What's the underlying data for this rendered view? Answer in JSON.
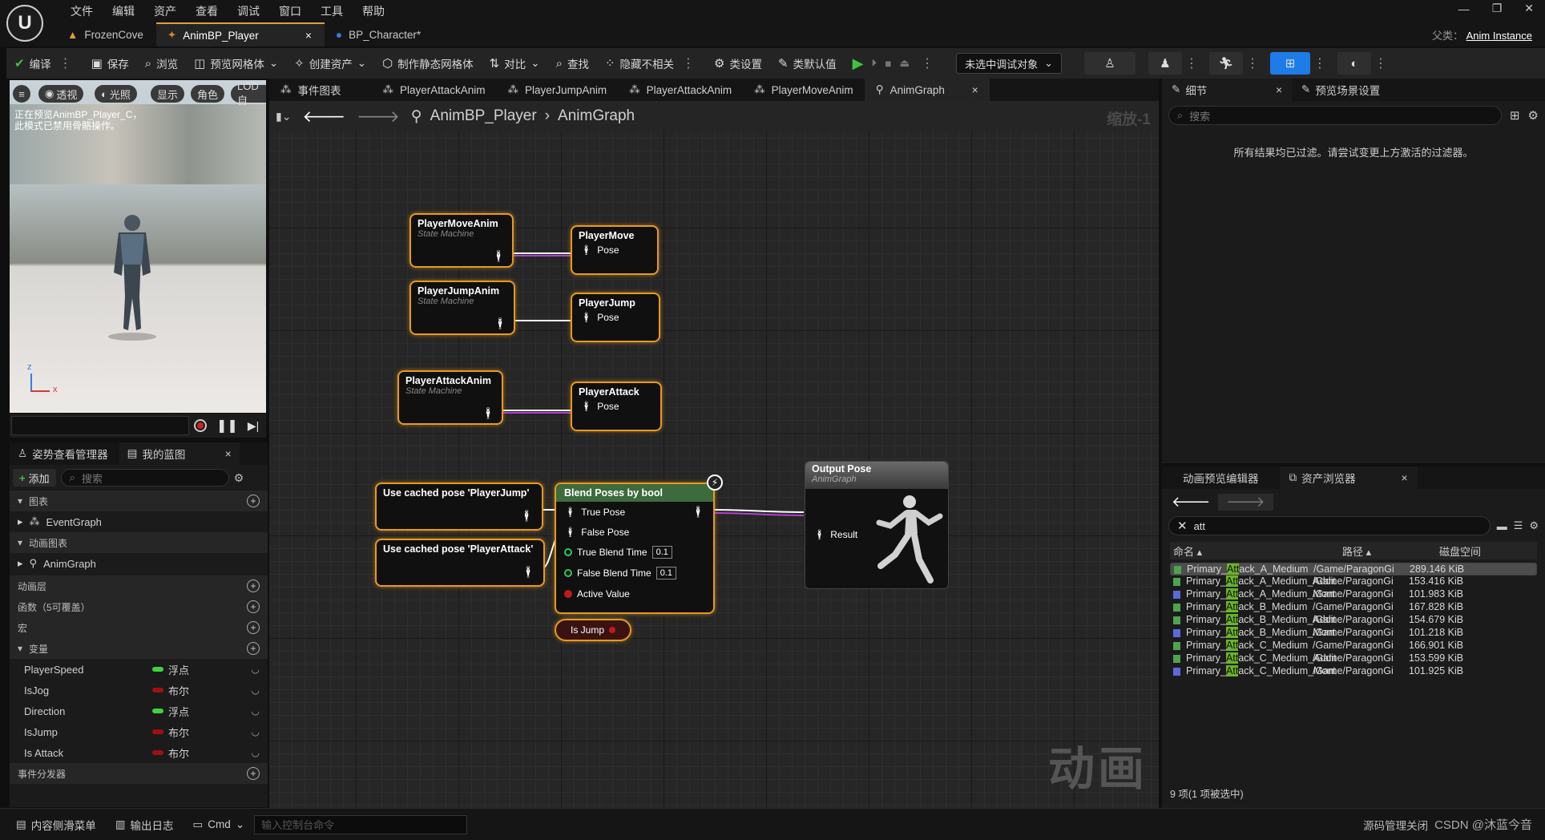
{
  "app": {
    "logo": "U"
  },
  "menu": [
    "文件",
    "编辑",
    "资产",
    "查看",
    "调试",
    "窗口",
    "工具",
    "帮助"
  ],
  "window_controls": [
    "—",
    "❐",
    "✕"
  ],
  "doc_tabs": [
    {
      "label": "FrozenCove",
      "icon": "level-icon"
    },
    {
      "label": "AnimBP_Player",
      "icon": "anim-icon",
      "close": "×"
    },
    {
      "label": "BP_Character*",
      "icon": "character-icon"
    }
  ],
  "parent": {
    "label": "父类：",
    "value": "Anim Instance"
  },
  "toolbar": {
    "compile": "编译",
    "save": "保存",
    "browse": "浏览",
    "preview_mesh": "预览网格体",
    "create_asset": "创建资产",
    "make_static": "制作静态网格体",
    "diff": "对比",
    "find": "查找",
    "hide_unrelated": "隐藏不相关",
    "class_settings": "类设置",
    "class_defaults": "类默认值",
    "debug_select": "未选中调试对象"
  },
  "viewport": {
    "buttons": [
      "≡",
      "透视",
      "光照",
      "显示",
      "角色",
      "LOD自"
    ],
    "notice_line1": "正在预览AnimBP_Player_C，",
    "notice_line2": "此模式已禁用骨骼操作。",
    "axis_x": "x",
    "axis_z": "z"
  },
  "left_panel": {
    "tab1": "姿势查看管理器",
    "tab2": "我的蓝图",
    "add": "添加",
    "search_placeholder": "搜索",
    "sections": {
      "graphs": "图表",
      "event_graph": "EventGraph",
      "anim_graphs": "动画图表",
      "anim_graph": "AnimGraph",
      "anim_layers": "动画层",
      "functions": "函数（5可覆盖）",
      "macros": "宏",
      "variables": "变量",
      "dispatchers": "事件分发器"
    },
    "variables": [
      {
        "name": "PlayerSpeed",
        "type": "浮点",
        "color": "#3ed33e"
      },
      {
        "name": "IsJog",
        "type": "布尔",
        "color": "#a01010"
      },
      {
        "name": "Direction",
        "type": "浮点",
        "color": "#3ed33e"
      },
      {
        "name": "IsJump",
        "type": "布尔",
        "color": "#a01010"
      },
      {
        "name": "Is Attack",
        "type": "布尔",
        "color": "#a01010"
      }
    ]
  },
  "graph_tabs": [
    "事件图表",
    "PlayerAttackAnim",
    "PlayerJumpAnim",
    "PlayerAttackAnim",
    "PlayerMoveAnim",
    "AnimGraph"
  ],
  "graph": {
    "crumb_root": "AnimBP_Player",
    "crumb_leaf": "AnimGraph",
    "zoom": "缩放-1",
    "watermark": "动画",
    "nodes": {
      "sm_move": {
        "title": "PlayerMoveAnim",
        "sub": "State Machine"
      },
      "sm_jump": {
        "title": "PlayerJumpAnim",
        "sub": "State Machine"
      },
      "sm_attack": {
        "title": "PlayerAttackAnim",
        "sub": "State Machine"
      },
      "cache_move": {
        "title": "PlayerMove",
        "pin": "Pose"
      },
      "cache_jump": {
        "title": "PlayerJump",
        "pin": "Pose"
      },
      "cache_attack": {
        "title": "PlayerAttack",
        "pin": "Pose"
      },
      "use_jump": {
        "title": "Use cached pose 'PlayerJump'"
      },
      "use_attack": {
        "title": "Use cached pose 'PlayerAttack'"
      },
      "blend": {
        "title": "Blend Poses by bool",
        "true_pose": "True Pose",
        "false_pose": "False Pose",
        "true_time": "True Blend Time",
        "true_time_val": "0.1",
        "false_time": "False Blend Time",
        "false_time_val": "0.1",
        "active": "Active Value"
      },
      "isjump": {
        "title": "Is Jump"
      },
      "output": {
        "title": "Output Pose",
        "sub": "AnimGraph",
        "pin": "Result"
      }
    }
  },
  "details": {
    "tab1": "细节",
    "tab2": "预览场景设置",
    "search_placeholder": "搜索",
    "message": "所有结果均已过滤。请尝试变更上方激活的过滤器。"
  },
  "assets": {
    "tab1": "动画预览编辑器",
    "tab2": "资产浏览器",
    "filter": "att",
    "col_name": "命名",
    "col_path": "路径",
    "col_size": "磁盘空间",
    "rows": [
      {
        "pre": "Primary_",
        "hl": "Att",
        "post": "ack_A_Medium",
        "path": "/Game/ParagonGi",
        "size": "289.146 KiB",
        "color": "#4fa34f",
        "selected": true
      },
      {
        "pre": "Primary_",
        "hl": "Att",
        "post": "ack_A_Medium_Addit",
        "path": "/Game/ParagonGi",
        "size": "153.416 KiB",
        "color": "#4fa34f"
      },
      {
        "pre": "Primary_",
        "hl": "Att",
        "post": "ack_A_Medium_Mont",
        "path": "/Game/ParagonGi",
        "size": "101.983 KiB",
        "color": "#5a6ad8"
      },
      {
        "pre": "Primary_",
        "hl": "Att",
        "post": "ack_B_Medium",
        "path": "/Game/ParagonGi",
        "size": "167.828 KiB",
        "color": "#4fa34f"
      },
      {
        "pre": "Primary_",
        "hl": "Att",
        "post": "ack_B_Medium_Addit",
        "path": "/Game/ParagonGi",
        "size": "154.679 KiB",
        "color": "#4fa34f"
      },
      {
        "pre": "Primary_",
        "hl": "Att",
        "post": "ack_B_Medium_Mont",
        "path": "/Game/ParagonGi",
        "size": "101.218 KiB",
        "color": "#5a6ad8"
      },
      {
        "pre": "Primary_",
        "hl": "Att",
        "post": "ack_C_Medium",
        "path": "/Game/ParagonGi",
        "size": "166.901 KiB",
        "color": "#4fa34f"
      },
      {
        "pre": "Primary_",
        "hl": "Att",
        "post": "ack_C_Medium_Addit",
        "path": "/Game/ParagonGi",
        "size": "153.599 KiB",
        "color": "#4fa34f"
      },
      {
        "pre": "Primary_",
        "hl": "Att",
        "post": "ack_C_Medium_Mont",
        "path": "/Game/ParagonGi",
        "size": "101.925 KiB",
        "color": "#5a6ad8"
      }
    ],
    "count": "9 项(1 项被选中)"
  },
  "statusbar": {
    "content_drawer": "内容侧滑菜单",
    "output_log": "输出日志",
    "cmd": "Cmd",
    "cmd_placeholder": "输入控制台命令",
    "source_control": "源码管理关闭",
    "watermark": "CSDN @沐蓝今音"
  }
}
